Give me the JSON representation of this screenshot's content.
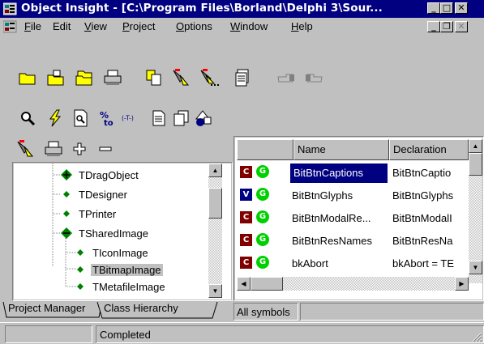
{
  "window": {
    "title": "Object Insight - [C:\\Program Files\\Borland\\Delphi 3\\Sour...",
    "minimize_glyph": "_",
    "maximize_glyph": "□",
    "close_glyph": "✕",
    "doc_minimize_glyph": "_",
    "doc_restore_glyph": "❐",
    "doc_close_glyph": "✕"
  },
  "menu": [
    {
      "accel": "F",
      "rest": "ile"
    },
    {
      "accel": "",
      "rest": "Edit"
    },
    {
      "accel": "V",
      "rest": "iew"
    },
    {
      "accel": "P",
      "rest": "roject"
    },
    {
      "accel": "O",
      "rest": "ptions"
    },
    {
      "accel": "W",
      "rest": "indow"
    },
    {
      "accel": "H",
      "rest": "elp"
    }
  ],
  "toolbar1": [
    "open-folder-icon",
    "new-folder-icon",
    "open-project-icon",
    "print-icon",
    "copy-icon",
    "filter-icon",
    "filter-more-icon",
    "properties-icon",
    "back-hand-icon",
    "forward-hand-icon"
  ],
  "toolbar2": [
    "search-icon",
    "lightning-icon",
    "document-search-icon",
    "percent-icon",
    "binding-icon",
    "page-icon",
    "pages-icon",
    "shapes-icon"
  ],
  "left_toolbar": [
    "filter-icon",
    "print-icon",
    "expand-icon",
    "collapse-icon"
  ],
  "tree": {
    "items": [
      {
        "label": "TDragObject",
        "kind": "expanded",
        "indent": 1
      },
      {
        "label": "TDesigner",
        "kind": "leaf",
        "indent": 1
      },
      {
        "label": "TPrinter",
        "kind": "leaf",
        "indent": 1
      },
      {
        "label": "TSharedImage",
        "kind": "expanded-open",
        "indent": 1
      },
      {
        "label": "TIconImage",
        "kind": "leaf",
        "indent": 2
      },
      {
        "label": "TBitmapImage",
        "kind": "leaf",
        "indent": 2,
        "selected": true
      },
      {
        "label": "TMetafileImage",
        "kind": "leaf",
        "indent": 2
      }
    ]
  },
  "tabs": {
    "project_manager": "Project Manager",
    "class_hierarchy": "Class Hierarchy"
  },
  "list": {
    "headers": [
      "Name",
      "Declaration"
    ],
    "rows": [
      {
        "type": "C",
        "type_color": "#800000",
        "name": "BitBtnCaptions",
        "decl": "BitBtnCaptio",
        "selected": true
      },
      {
        "type": "V",
        "type_color": "#000080",
        "name": "BitBtnGlyphs",
        "decl": "BitBtnGlyphs",
        "selected": false
      },
      {
        "type": "C",
        "type_color": "#800000",
        "name": "BitBtnModalRe...",
        "decl": "BitBtnModalI",
        "selected": false
      },
      {
        "type": "C",
        "type_color": "#800000",
        "name": "BitBtnResNames",
        "decl": "BitBtnResNa",
        "selected": false
      },
      {
        "type": "C",
        "type_color": "#800000",
        "name": "bkAbort",
        "decl": "bkAbort = TE",
        "selected": false
      }
    ],
    "scope_badge": "G"
  },
  "symbols_bar": {
    "label": "All symbols"
  },
  "status": {
    "message": "Completed"
  },
  "colors": {
    "titlebar": "#000080",
    "selection": "#000080",
    "face": "#c0c0c0"
  }
}
